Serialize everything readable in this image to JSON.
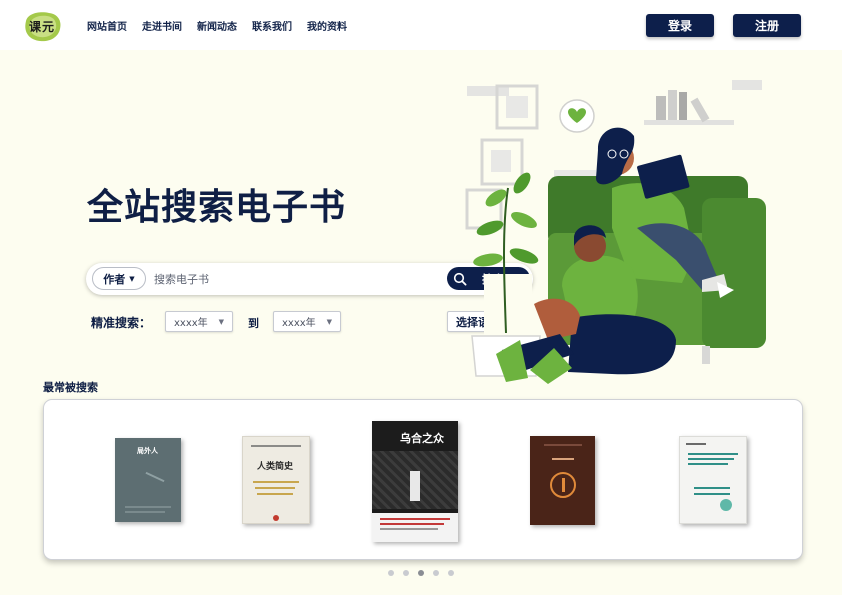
{
  "nav": {
    "logo_text": "课元",
    "links": [
      "网站首页",
      "走进书间",
      "新闻动态",
      "联系我们",
      "我的资料"
    ],
    "login_label": "登录",
    "register_label": "注册"
  },
  "hero": {
    "title": "全站搜索电子书"
  },
  "search": {
    "field_selected": "作者",
    "placeholder": "搜索电子书",
    "button_label": "搜索"
  },
  "filters": {
    "label": "精准搜索：",
    "year_from": "xxxx年",
    "to_label": "到",
    "year_to": "xxxx年",
    "language": "选择语言"
  },
  "popular": {
    "title": "最常被搜索",
    "books": [
      {
        "title": "局外人",
        "cover_color": "#5d6e72"
      },
      {
        "title": "人类简史",
        "cover_color": "#eeebe2"
      },
      {
        "title": "乌合之众",
        "cover_color": "#1c1c1c"
      },
      {
        "title": "",
        "cover_color": "#4a2418"
      },
      {
        "title": "",
        "cover_color": "#f4f4f2"
      }
    ],
    "page_count": 5,
    "active_page": 3
  },
  "colors": {
    "navy": "#0d1f4b",
    "accent_green": "#6db33f",
    "page_bg": "#fdfdf0"
  }
}
